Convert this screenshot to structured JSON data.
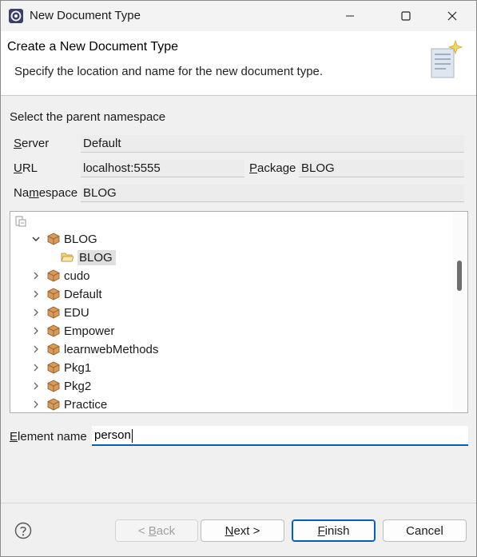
{
  "window": {
    "title": "New Document Type"
  },
  "banner": {
    "title": "Create a New Document Type",
    "subtitle": "Specify the location and name for the new document type."
  },
  "form": {
    "section_label": "Select the parent namespace",
    "server_label_key": "S",
    "server_label_rest": "erver",
    "server_value": "Default",
    "url_label_key": "U",
    "url_label_rest": "RL",
    "url_value": "localhost:5555",
    "package_label_key": "P",
    "package_label_rest": "ackage",
    "package_value": "BLOG",
    "namespace_label_pre": "Na",
    "namespace_label_key": "m",
    "namespace_label_rest": "espace",
    "namespace_value": "BLOG"
  },
  "tree": {
    "root": {
      "label": "BLOG",
      "expanded": true
    },
    "child": {
      "label": "BLOG",
      "selected": true
    },
    "items": [
      {
        "label": "cudo"
      },
      {
        "label": "Default"
      },
      {
        "label": "EDU"
      },
      {
        "label": "Empower"
      },
      {
        "label": "learnwebMethods"
      },
      {
        "label": "Pkg1"
      },
      {
        "label": "Pkg2"
      },
      {
        "label": "Practice"
      }
    ]
  },
  "element": {
    "label_key": "E",
    "label_rest": "lement name",
    "value": "person"
  },
  "buttons": {
    "back_pre": "< ",
    "back_key": "B",
    "back_rest": "ack",
    "next_key": "N",
    "next_rest": "ext >",
    "finish_key": "F",
    "finish_rest": "inish",
    "cancel": "Cancel"
  },
  "colors": {
    "accent": "#005fb8",
    "package_icon": "#c8884a"
  }
}
